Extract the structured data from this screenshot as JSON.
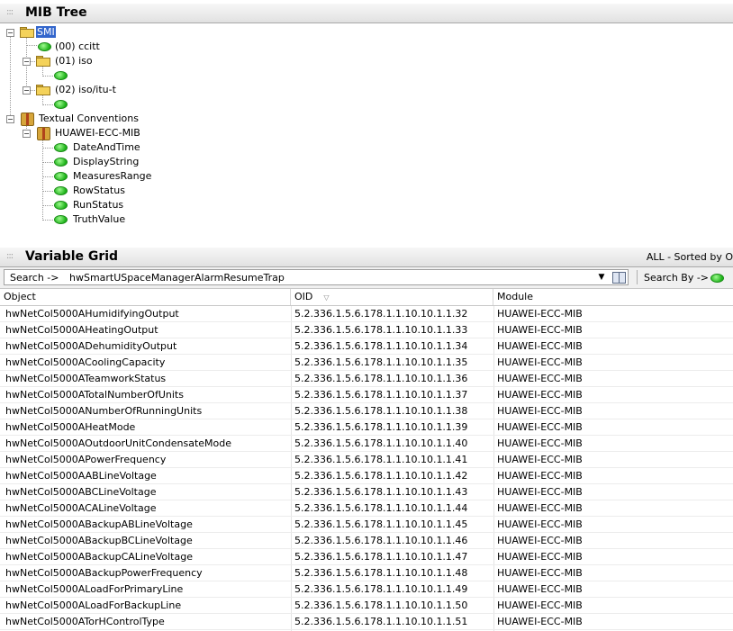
{
  "mib_tree": {
    "title": "MIB Tree",
    "nodes": {
      "smi": "SMI",
      "ccitt": "(00) ccitt",
      "iso": "(01) iso",
      "iso_itu": "(02) iso/itu-t",
      "textual_conventions": "Textual Conventions",
      "huawei_ecc_mib": "HUAWEI-ECC-MIB",
      "tc_items": [
        "DateAndTime",
        "DisplayString",
        "MeasuresRange",
        "RowStatus",
        "RunStatus",
        "TruthValue"
      ]
    },
    "icons": {
      "folder": "folder-icon",
      "leaf": "green-leaf-icon",
      "module": "package-icon"
    }
  },
  "variable_grid": {
    "title": "Variable Grid",
    "status": "ALL - Sorted by O",
    "search": {
      "prefix": "Search ->",
      "value": "hwSmartUSpaceManagerAlarmResumeTrap",
      "search_by_label": "Search By ->"
    },
    "columns": [
      "Object",
      "OID",
      "Module"
    ],
    "rows": [
      [
        "hwNetCol5000AHumidifyingOutput",
        "5.2.336.1.5.6.178.1.1.10.10.1.1.32",
        "HUAWEI-ECC-MIB"
      ],
      [
        "hwNetCol5000AHeatingOutput",
        "5.2.336.1.5.6.178.1.1.10.10.1.1.33",
        "HUAWEI-ECC-MIB"
      ],
      [
        "hwNetCol5000ADehumidityOutput",
        "5.2.336.1.5.6.178.1.1.10.10.1.1.34",
        "HUAWEI-ECC-MIB"
      ],
      [
        "hwNetCol5000ACoolingCapacity",
        "5.2.336.1.5.6.178.1.1.10.10.1.1.35",
        "HUAWEI-ECC-MIB"
      ],
      [
        "hwNetCol5000ATeamworkStatus",
        "5.2.336.1.5.6.178.1.1.10.10.1.1.36",
        "HUAWEI-ECC-MIB"
      ],
      [
        "hwNetCol5000ATotalNumberOfUnits",
        "5.2.336.1.5.6.178.1.1.10.10.1.1.37",
        "HUAWEI-ECC-MIB"
      ],
      [
        "hwNetCol5000ANumberOfRunningUnits",
        "5.2.336.1.5.6.178.1.1.10.10.1.1.38",
        "HUAWEI-ECC-MIB"
      ],
      [
        "hwNetCol5000AHeatMode",
        "5.2.336.1.5.6.178.1.1.10.10.1.1.39",
        "HUAWEI-ECC-MIB"
      ],
      [
        "hwNetCol5000AOutdoorUnitCondensateMode",
        "5.2.336.1.5.6.178.1.1.10.10.1.1.40",
        "HUAWEI-ECC-MIB"
      ],
      [
        "hwNetCol5000APowerFrequency",
        "5.2.336.1.5.6.178.1.1.10.10.1.1.41",
        "HUAWEI-ECC-MIB"
      ],
      [
        "hwNetCol5000AABLineVoltage",
        "5.2.336.1.5.6.178.1.1.10.10.1.1.42",
        "HUAWEI-ECC-MIB"
      ],
      [
        "hwNetCol5000ABCLineVoltage",
        "5.2.336.1.5.6.178.1.1.10.10.1.1.43",
        "HUAWEI-ECC-MIB"
      ],
      [
        "hwNetCol5000ACALineVoltage",
        "5.2.336.1.5.6.178.1.1.10.10.1.1.44",
        "HUAWEI-ECC-MIB"
      ],
      [
        "hwNetCol5000ABackupABLineVoltage",
        "5.2.336.1.5.6.178.1.1.10.10.1.1.45",
        "HUAWEI-ECC-MIB"
      ],
      [
        "hwNetCol5000ABackupBCLineVoltage",
        "5.2.336.1.5.6.178.1.1.10.10.1.1.46",
        "HUAWEI-ECC-MIB"
      ],
      [
        "hwNetCol5000ABackupCALineVoltage",
        "5.2.336.1.5.6.178.1.1.10.10.1.1.47",
        "HUAWEI-ECC-MIB"
      ],
      [
        "hwNetCol5000ABackupPowerFrequency",
        "5.2.336.1.5.6.178.1.1.10.10.1.1.48",
        "HUAWEI-ECC-MIB"
      ],
      [
        "hwNetCol5000ALoadForPrimaryLine",
        "5.2.336.1.5.6.178.1.1.10.10.1.1.49",
        "HUAWEI-ECC-MIB"
      ],
      [
        "hwNetCol5000ALoadForBackupLine",
        "5.2.336.1.5.6.178.1.1.10.10.1.1.50",
        "HUAWEI-ECC-MIB"
      ],
      [
        "hwNetCol5000ATorHControlType",
        "5.2.336.1.5.6.178.1.1.10.10.1.1.51",
        "HUAWEI-ECC-MIB"
      ]
    ]
  }
}
